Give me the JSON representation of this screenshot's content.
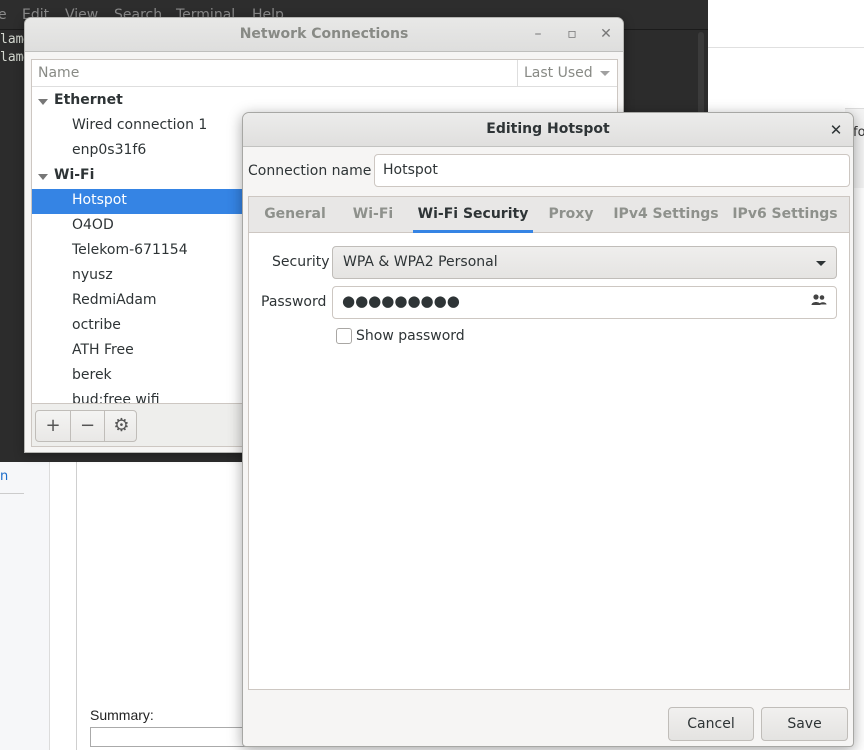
{
  "background": {
    "left_link": "n",
    "summary_label": "Summary:",
    "right_fragment": "fo"
  },
  "terminal": {
    "menu": [
      "e",
      "Edit",
      "View",
      "Search",
      "Terminal",
      "Help"
    ],
    "lines": [
      "lam@",
      "lam@"
    ]
  },
  "network_connections": {
    "title": "Network Connections",
    "columns": {
      "name": "Name",
      "last_used": "Last Used"
    },
    "groups": [
      {
        "label": "Ethernet",
        "items": [
          "Wired connection 1",
          "enp0s31f6"
        ]
      },
      {
        "label": "Wi-Fi",
        "items": [
          "Hotspot",
          "O4OD",
          "Telekom-671154",
          "nyusz",
          "RedmiAdam",
          "octribe",
          "ATH Free",
          "berek",
          "bud:free wifi"
        ]
      }
    ],
    "selected": "Hotspot",
    "toolbar": {
      "add": "+",
      "remove": "−",
      "settings": "⚙"
    }
  },
  "editor": {
    "title": "Editing Hotspot",
    "connection_name_label": "Connection name",
    "connection_name_value": "Hotspot",
    "tabs": [
      "General",
      "Wi-Fi",
      "Wi-Fi Security",
      "Proxy",
      "IPv4 Settings",
      "IPv6 Settings"
    ],
    "active_tab": "Wi-Fi Security",
    "security_label": "Security",
    "security_value": "WPA & WPA2 Personal",
    "password_label": "Password",
    "password_masked": "●●●●●●●●●",
    "show_password_label": "Show password",
    "show_password_checked": false,
    "cancel_label": "Cancel",
    "save_label": "Save"
  },
  "colors": {
    "accent": "#3584e4",
    "terminal_bg": "#2c2c2c"
  }
}
